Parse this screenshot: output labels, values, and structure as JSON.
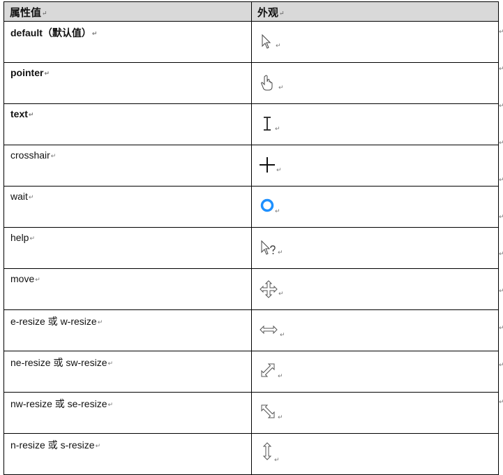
{
  "header": {
    "col_value": "属性值",
    "col_look": "外观"
  },
  "rows": [
    {
      "value": "default（默认值）",
      "bold": true,
      "icon": "arrow-pointer-icon"
    },
    {
      "value": "pointer",
      "bold": true,
      "icon": "hand-pointer-icon"
    },
    {
      "value": "text",
      "bold": true,
      "icon": "text-ibeam-icon"
    },
    {
      "value": "crosshair",
      "bold": false,
      "icon": "crosshair-icon"
    },
    {
      "value": "wait",
      "bold": false,
      "icon": "busy-ring-icon"
    },
    {
      "value": "help",
      "bold": false,
      "icon": "help-arrow-icon"
    },
    {
      "value": "move",
      "bold": false,
      "icon": "move-arrows-icon"
    },
    {
      "value": "e-resize 或 w-resize",
      "bold": false,
      "icon": "horizontal-resize-icon"
    },
    {
      "value": "ne-resize 或 sw-resize",
      "bold": false,
      "icon": "diagonal-ne-sw-resize-icon"
    },
    {
      "value": "nw-resize 或 se-resize",
      "bold": false,
      "icon": "diagonal-nw-se-resize-icon"
    },
    {
      "value": "n-resize 或 s-resize",
      "bold": false,
      "icon": "vertical-resize-icon"
    }
  ],
  "paragraph_mark": "↵",
  "colors": {
    "header_bg": "#d9d9d9",
    "busy_ring": "#1e90ff",
    "border": "#000000"
  }
}
